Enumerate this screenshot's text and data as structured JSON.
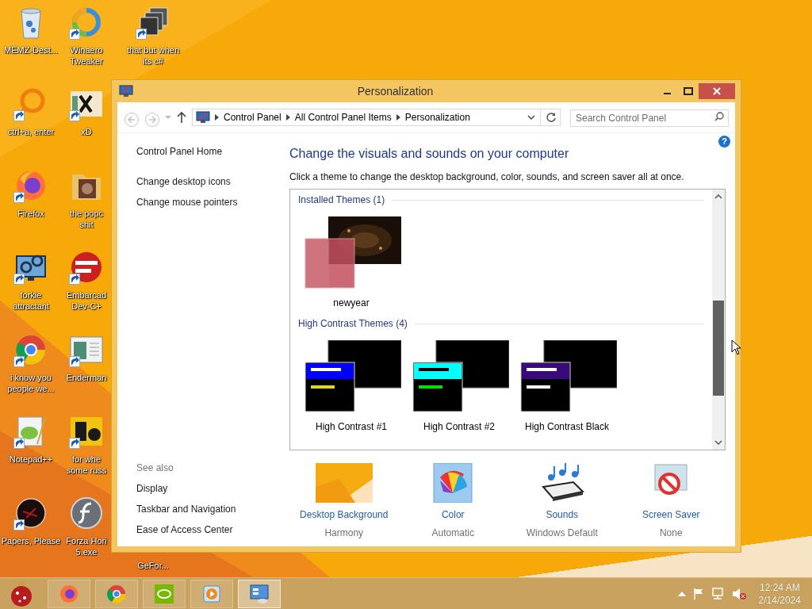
{
  "desktop": {
    "columns": [
      [
        {
          "label": "MEMZ-Dest...",
          "kind": "recycle",
          "shortcut": false
        },
        {
          "label": "ctrl+a, enter",
          "kind": "ring",
          "shortcut": true
        },
        {
          "label": "Firefox",
          "kind": "fox",
          "shortcut": true
        },
        {
          "label": "forkie\nattractant",
          "kind": "gears",
          "shortcut": true
        },
        {
          "label": "i know you\npeople we...",
          "kind": "chrome",
          "shortcut": true
        },
        {
          "label": "Notepad++",
          "kind": "notepad",
          "shortcut": true
        },
        {
          "label": "Papers, Please",
          "kind": "darkball",
          "shortcut": true
        }
      ],
      [
        {
          "label": "Winaero\nTweaker",
          "kind": "swirl",
          "shortcut": true
        },
        {
          "label": "xD",
          "kind": "hex",
          "shortcut": true
        },
        {
          "label": "the popc\nshit",
          "kind": "folder",
          "shortcut": false
        },
        {
          "label": "Embarcad\nDev-C+",
          "kind": "devcpp",
          "shortcut": true
        },
        {
          "label": "Enderman",
          "kind": "doc",
          "shortcut": true
        },
        {
          "label": "for whe\nsome russ",
          "kind": "letters",
          "shortcut": true
        },
        {
          "label": "Forza Hori\n5.exe",
          "kind": "flash",
          "shortcut": false
        }
      ],
      [
        {
          "label": "that but when\nits c#",
          "kind": "stack",
          "shortcut": true
        },
        {
          "label": "GeFor...",
          "kind": "covered"
        }
      ]
    ]
  },
  "window": {
    "title": "Personalization"
  },
  "address": {
    "back": {
      "disabled": true
    },
    "forward": {
      "disabled": true
    },
    "crumbs": [
      "Control Panel",
      "All Control Panel Items",
      "Personalization"
    ],
    "search": {
      "placeholder": "Search Control Panel"
    }
  },
  "sidebar": {
    "home": "Control Panel Home",
    "tasks": [
      "Change desktop icons",
      "Change mouse pointers"
    ],
    "see_also_title": "See also",
    "see_also": [
      "Display",
      "Taskbar and Navigation",
      "Ease of Access Center"
    ]
  },
  "main": {
    "heading": "Change the visuals and sounds on your computer",
    "description": "Click a theme to change the desktop background, color, sounds, and screen saver all at once.",
    "help": "?"
  },
  "theme_groups": [
    {
      "title": "Installed Themes (1)",
      "themes": [
        {
          "name": "newyear",
          "kind": "picture"
        }
      ]
    },
    {
      "title": "High Contrast Themes (4)",
      "themes": [
        {
          "name": "High Contrast #1",
          "kind": "contrast1"
        },
        {
          "name": "High Contrast #2",
          "kind": "contrast2"
        },
        {
          "name": "High Contrast Black",
          "kind": "contrastblack"
        }
      ]
    }
  ],
  "settings": [
    {
      "label": "Desktop Background",
      "value": "Harmony",
      "kind": "background"
    },
    {
      "label": "Color",
      "value": "Automatic",
      "kind": "color"
    },
    {
      "label": "Sounds",
      "value": "Windows Default",
      "kind": "sounds"
    },
    {
      "label": "Screen Saver",
      "value": "None",
      "kind": "screensaver"
    }
  ],
  "taskbar": {
    "apps": [
      {
        "kind": "fox",
        "selected": false
      },
      {
        "kind": "chrome",
        "selected": false
      },
      {
        "kind": "gpu",
        "selected": false
      },
      {
        "kind": "media",
        "selected": false
      },
      {
        "kind": "panel",
        "selected": true
      }
    ],
    "clock": {
      "time": "12:24 AM",
      "date": "2/14/2024"
    }
  }
}
